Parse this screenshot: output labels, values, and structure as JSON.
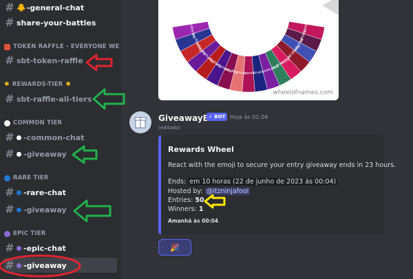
{
  "sidebar": {
    "channels_top": [
      {
        "label": "-general-chat",
        "prefix_emoji": "🐥"
      },
      {
        "label": "share-your-battles"
      }
    ],
    "categories": [
      {
        "label": "TOKEN RAFFLE - EVERYONE WE...",
        "icon_color": "#e1523d",
        "channels": [
          {
            "label": "sbt-token-raffle"
          }
        ]
      },
      {
        "label": "REWARDS-TIER",
        "icon_color": "#f0c419",
        "channels": [
          {
            "label": "sbt-raffle-all-tiers"
          }
        ]
      },
      {
        "label": "COMMON TIER",
        "icon_color": "#ffffff",
        "channels": [
          {
            "label": "-common-chat"
          },
          {
            "label": "-giveaway"
          }
        ]
      },
      {
        "label": "RARE TIER",
        "icon_color": "#1f78d1",
        "channels": [
          {
            "label": "-rare-chat"
          },
          {
            "label": "-giveaway"
          }
        ]
      },
      {
        "label": "EPIC TIER",
        "icon_color": "#8c6bd6",
        "channels": [
          {
            "label": "-epic-chat"
          },
          {
            "label": "-giveaway"
          }
        ]
      }
    ]
  },
  "wheel": {
    "credit": "wheelofnames.com",
    "segments": [
      "Scoreindeing",
      "Dawgholder",
      "ScoobyDoo",
      "GremlinBlaste",
      "Phantom",
      "AnimatedFortune",
      "GF-SlowLeech",
      "Rivals",
      "Reenie",
      "Phenolic",
      "HappyBoy",
      "GlaneScorpion",
      "AngeloSteve",
      "TechnoHunter",
      "AiGamerAd",
      "Pumpkin Flavored",
      "AchillesTwo"
    ]
  },
  "message": {
    "author": "GiveawayBot",
    "badge": "✓ BOT",
    "timestamp": "Hoje às 01:04",
    "edited": "(editado)",
    "embed": {
      "title": "Rewards Wheel",
      "description": "React with the emoji to secure your entry giveaway ends in 23 hours.",
      "ends_label": "Ends:",
      "ends_value": "em 10 horas",
      "ends_date": "(22 de junho de 2023 às 00:04)",
      "hosted_label": "Hosted by:",
      "hosted_value": "@itzninjafool",
      "entries_label": "Entries:",
      "entries_value": "50",
      "winners_label": "Winners:",
      "winners_value": "1",
      "footer": "Amanhã às 00:04",
      "accent": "#5865f2"
    },
    "reaction": {
      "emoji": "🎉"
    }
  },
  "annotations": {
    "arrow_red": "#e0242f",
    "arrow_green": "#22b14c",
    "arrow_yellow": "#ffe800"
  }
}
